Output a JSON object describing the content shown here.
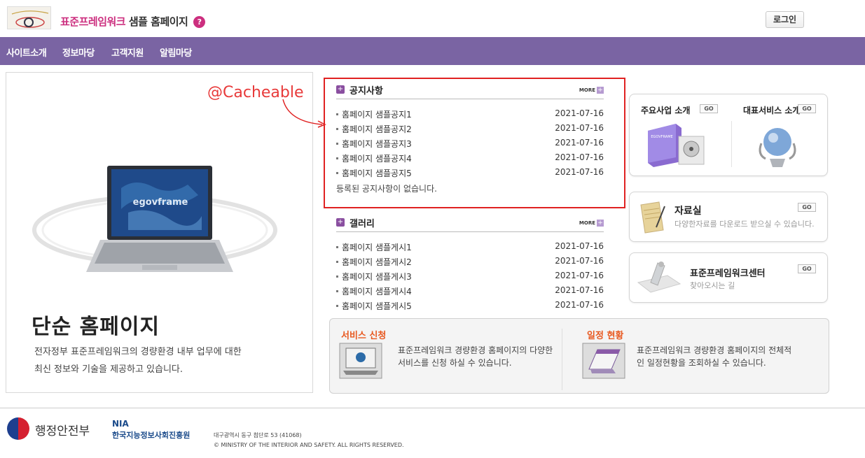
{
  "header": {
    "title_highlight": "표준프레임워크",
    "title_rest": " 샘플 홈페이지",
    "help_glyph": "?",
    "login_label": "로그인",
    "colors": {
      "brand": "#cc2f7f",
      "nav_bg": "#7a64a3",
      "accent_orange": "#e8581f",
      "annotation_red": "#e02222"
    }
  },
  "nav": {
    "items": [
      "사이트소개",
      "정보마당",
      "고객지원",
      "알림마당"
    ]
  },
  "hero": {
    "screen_text": "egovframe",
    "title": "단순 홈페이지",
    "desc_line1": "전자정부 표준프레임워크의 경량환경 내부 업무에 대한",
    "desc_line2": "최신 정보와 기술을 제공하고 있습니다."
  },
  "annotation": {
    "label": "@Cacheable"
  },
  "notice": {
    "title": "공지사항",
    "more": "MORE",
    "items": [
      {
        "title": "홈페이지 샘플공지1",
        "date": "2021-07-16"
      },
      {
        "title": "홈페이지 샘플공지2",
        "date": "2021-07-16"
      },
      {
        "title": "홈페이지 샘플공지3",
        "date": "2021-07-16"
      },
      {
        "title": "홈페이지 샘플공지4",
        "date": "2021-07-16"
      },
      {
        "title": "홈페이지 샘플공지5",
        "date": "2021-07-16"
      }
    ],
    "empty_text": "등록된 공지사항이 없습니다."
  },
  "gallery": {
    "title": "갤러리",
    "more": "MORE",
    "items": [
      {
        "title": "홈페이지 샘플게시1",
        "date": "2021-07-16"
      },
      {
        "title": "홈페이지 샘플게시2",
        "date": "2021-07-16"
      },
      {
        "title": "홈페이지 샘플게시3",
        "date": "2021-07-16"
      },
      {
        "title": "홈페이지 샘플게시4",
        "date": "2021-07-16"
      },
      {
        "title": "홈페이지 샘플게시5",
        "date": "2021-07-16"
      }
    ]
  },
  "business": {
    "main_title": "주요사업 소개",
    "rep_title": "대표서비스 소개",
    "product_label": "EGOVFRAME",
    "go": "GO"
  },
  "archive": {
    "title": "자료실",
    "desc": "다양한자료를 다운로드 받으실 수 있습니다.",
    "go": "GO"
  },
  "center": {
    "title": "표준프레임워크센터",
    "desc": "찾아오시는 길",
    "go": "GO"
  },
  "services": {
    "apply_title": "서비스 신청",
    "apply_desc1": "표준프레임워크 경량환경 홈페이지의 다양한",
    "apply_desc2": "서비스를 신청 하실 수 있습니다.",
    "schedule_title": "일정 현황",
    "schedule_desc1": "표준프레임워크 경량환경 홈페이지의 전체적",
    "schedule_desc2": "인 일정현황을 조회하실 수 있습니다."
  },
  "footer": {
    "ministry": "행정안전부",
    "nia": "NIA",
    "nia_name": "한국지능정보사회진흥원",
    "address": "대구광역시 동구 첨단로 53 (41068)",
    "copyright": "© MINISTRY OF THE INTERIOR AND SAFETY. ALL RIGHTS RESERVED."
  }
}
